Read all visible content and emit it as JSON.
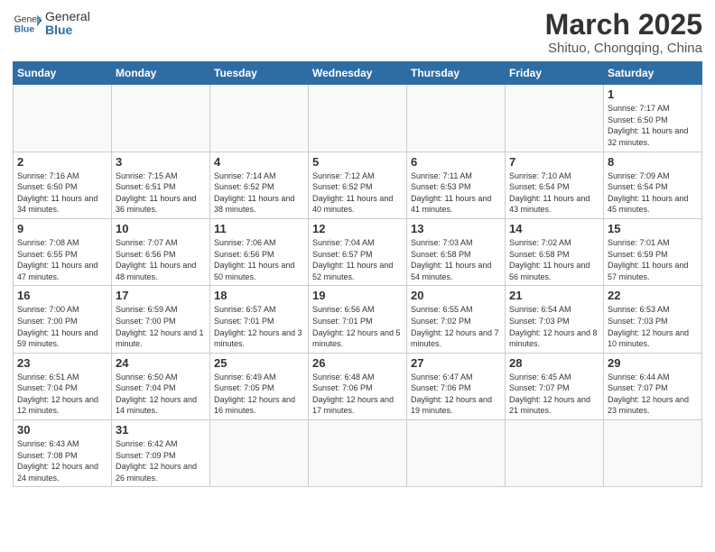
{
  "header": {
    "logo_general": "General",
    "logo_blue": "Blue",
    "title": "March 2025",
    "subtitle": "Shituo, Chongqing, China"
  },
  "weekdays": [
    "Sunday",
    "Monday",
    "Tuesday",
    "Wednesday",
    "Thursday",
    "Friday",
    "Saturday"
  ],
  "weeks": [
    [
      {
        "day": "",
        "info": ""
      },
      {
        "day": "",
        "info": ""
      },
      {
        "day": "",
        "info": ""
      },
      {
        "day": "",
        "info": ""
      },
      {
        "day": "",
        "info": ""
      },
      {
        "day": "",
        "info": ""
      },
      {
        "day": "1",
        "info": "Sunrise: 7:17 AM\nSunset: 6:50 PM\nDaylight: 11 hours\nand 32 minutes."
      }
    ],
    [
      {
        "day": "2",
        "info": "Sunrise: 7:16 AM\nSunset: 6:50 PM\nDaylight: 11 hours\nand 34 minutes."
      },
      {
        "day": "3",
        "info": "Sunrise: 7:15 AM\nSunset: 6:51 PM\nDaylight: 11 hours\nand 36 minutes."
      },
      {
        "day": "4",
        "info": "Sunrise: 7:14 AM\nSunset: 6:52 PM\nDaylight: 11 hours\nand 38 minutes."
      },
      {
        "day": "5",
        "info": "Sunrise: 7:12 AM\nSunset: 6:52 PM\nDaylight: 11 hours\nand 40 minutes."
      },
      {
        "day": "6",
        "info": "Sunrise: 7:11 AM\nSunset: 6:53 PM\nDaylight: 11 hours\nand 41 minutes."
      },
      {
        "day": "7",
        "info": "Sunrise: 7:10 AM\nSunset: 6:54 PM\nDaylight: 11 hours\nand 43 minutes."
      },
      {
        "day": "8",
        "info": "Sunrise: 7:09 AM\nSunset: 6:54 PM\nDaylight: 11 hours\nand 45 minutes."
      }
    ],
    [
      {
        "day": "9",
        "info": "Sunrise: 7:08 AM\nSunset: 6:55 PM\nDaylight: 11 hours\nand 47 minutes."
      },
      {
        "day": "10",
        "info": "Sunrise: 7:07 AM\nSunset: 6:56 PM\nDaylight: 11 hours\nand 48 minutes."
      },
      {
        "day": "11",
        "info": "Sunrise: 7:06 AM\nSunset: 6:56 PM\nDaylight: 11 hours\nand 50 minutes."
      },
      {
        "day": "12",
        "info": "Sunrise: 7:04 AM\nSunset: 6:57 PM\nDaylight: 11 hours\nand 52 minutes."
      },
      {
        "day": "13",
        "info": "Sunrise: 7:03 AM\nSunset: 6:58 PM\nDaylight: 11 hours\nand 54 minutes."
      },
      {
        "day": "14",
        "info": "Sunrise: 7:02 AM\nSunset: 6:58 PM\nDaylight: 11 hours\nand 56 minutes."
      },
      {
        "day": "15",
        "info": "Sunrise: 7:01 AM\nSunset: 6:59 PM\nDaylight: 11 hours\nand 57 minutes."
      }
    ],
    [
      {
        "day": "16",
        "info": "Sunrise: 7:00 AM\nSunset: 7:00 PM\nDaylight: 11 hours\nand 59 minutes."
      },
      {
        "day": "17",
        "info": "Sunrise: 6:59 AM\nSunset: 7:00 PM\nDaylight: 12 hours\nand 1 minute."
      },
      {
        "day": "18",
        "info": "Sunrise: 6:57 AM\nSunset: 7:01 PM\nDaylight: 12 hours\nand 3 minutes."
      },
      {
        "day": "19",
        "info": "Sunrise: 6:56 AM\nSunset: 7:01 PM\nDaylight: 12 hours\nand 5 minutes."
      },
      {
        "day": "20",
        "info": "Sunrise: 6:55 AM\nSunset: 7:02 PM\nDaylight: 12 hours\nand 7 minutes."
      },
      {
        "day": "21",
        "info": "Sunrise: 6:54 AM\nSunset: 7:03 PM\nDaylight: 12 hours\nand 8 minutes."
      },
      {
        "day": "22",
        "info": "Sunrise: 6:53 AM\nSunset: 7:03 PM\nDaylight: 12 hours\nand 10 minutes."
      }
    ],
    [
      {
        "day": "23",
        "info": "Sunrise: 6:51 AM\nSunset: 7:04 PM\nDaylight: 12 hours\nand 12 minutes."
      },
      {
        "day": "24",
        "info": "Sunrise: 6:50 AM\nSunset: 7:04 PM\nDaylight: 12 hours\nand 14 minutes."
      },
      {
        "day": "25",
        "info": "Sunrise: 6:49 AM\nSunset: 7:05 PM\nDaylight: 12 hours\nand 16 minutes."
      },
      {
        "day": "26",
        "info": "Sunrise: 6:48 AM\nSunset: 7:06 PM\nDaylight: 12 hours\nand 17 minutes."
      },
      {
        "day": "27",
        "info": "Sunrise: 6:47 AM\nSunset: 7:06 PM\nDaylight: 12 hours\nand 19 minutes."
      },
      {
        "day": "28",
        "info": "Sunrise: 6:45 AM\nSunset: 7:07 PM\nDaylight: 12 hours\nand 21 minutes."
      },
      {
        "day": "29",
        "info": "Sunrise: 6:44 AM\nSunset: 7:07 PM\nDaylight: 12 hours\nand 23 minutes."
      }
    ],
    [
      {
        "day": "30",
        "info": "Sunrise: 6:43 AM\nSunset: 7:08 PM\nDaylight: 12 hours\nand 24 minutes."
      },
      {
        "day": "31",
        "info": "Sunrise: 6:42 AM\nSunset: 7:09 PM\nDaylight: 12 hours\nand 26 minutes."
      },
      {
        "day": "",
        "info": ""
      },
      {
        "day": "",
        "info": ""
      },
      {
        "day": "",
        "info": ""
      },
      {
        "day": "",
        "info": ""
      },
      {
        "day": "",
        "info": ""
      }
    ]
  ]
}
